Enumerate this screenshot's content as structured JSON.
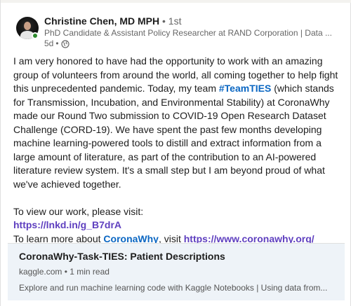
{
  "author": {
    "name": "Christine Chen, MD MPH",
    "degree": "• 1st",
    "headline": "PhD Candidate & Assistant Policy Researcher at RAND Corporation | Data ...",
    "time": "5d",
    "visibility_sep": "•",
    "visibility_icon": "globe-icon"
  },
  "post": {
    "p1_a": "I am very honored to have had the opportunity to work with an amazing group of volunteers from around the world, all coming together to help fight this unprecedented pandemic. Today, my team ",
    "hashtag": "#TeamTIES",
    "p1_b": " (which stands for Transmission, Incubation, and Environmental Stability) at CoronaWhy made our Round Two submission to COVID-19 Open Research Dataset Challenge (CORD-19). We have spent the past few months developing machine learning-powered tools to distill and extract information from a large amount of literature, as part of the contribution to an AI-powered literature review system. It's a small step but I am beyond proud of what we've achieved together.",
    "view_intro": "To view our work, please visit:",
    "view_link": "https://lnkd.in/g_B7drA",
    "learn_a": "To learn more about ",
    "mention": "CoronaWhy",
    "learn_b": ", visit ",
    "learn_link": "https://www.coronawhy.org/"
  },
  "preview": {
    "title": "CoronaWhy-Task-TIES: Patient Descriptions",
    "source": "kaggle.com • 1 min read",
    "description": "Explore and run machine learning code with Kaggle Notebooks | Using data from..."
  },
  "colors": {
    "hashtag": "#0a66c2",
    "link": "#5e3fbf",
    "online": "#2e8a2e",
    "preview_bg": "#eef3f8"
  }
}
